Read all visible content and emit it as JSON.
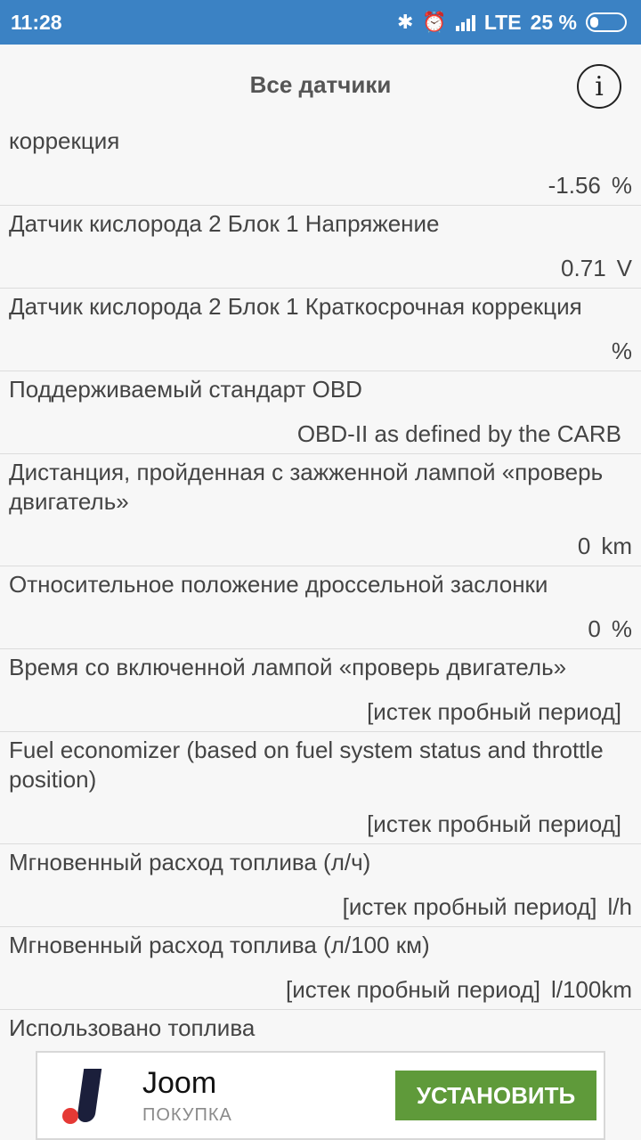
{
  "status_bar": {
    "time": "11:28",
    "network": "LTE",
    "battery_percent_text": "25 %",
    "battery_level": 0.25,
    "icons": [
      "bluetooth-icon",
      "alarm-icon",
      "signal-icon",
      "battery-icon"
    ]
  },
  "header": {
    "title": "Все датчики",
    "info_icon": "i"
  },
  "sensors": [
    {
      "label": "коррекция",
      "value": "-1.56",
      "unit": "%"
    },
    {
      "label": "Датчик кислорода 2 Блок 1 Напряжение",
      "value": "0.71",
      "unit": "V"
    },
    {
      "label": "Датчик кислорода 2 Блок 1 Краткосрочная коррекция",
      "value": "",
      "unit": "%"
    },
    {
      "label": "Поддерживаемый стандарт OBD",
      "value": "OBD-II as defined by the CARB",
      "unit": ""
    },
    {
      "label": "Дистанция, пройденная с зажженной лампой «проверь двигатель»",
      "value": "0",
      "unit": "km"
    },
    {
      "label": "Относительное положение дроссельной заслонки",
      "value": "0",
      "unit": "%"
    },
    {
      "label": "Время со включенной лампой «проверь двигатель»",
      "value": "[истек пробный период]",
      "unit": ""
    },
    {
      "label": "Fuel economizer (based on fuel system status and throttle position)",
      "value": "[истек пробный период]",
      "unit": ""
    },
    {
      "label": "Мгновенный расход топлива (л/ч)",
      "value": "[истек пробный период]",
      "unit": "l/h"
    },
    {
      "label": "Мгновенный расход топлива (л/100 км)",
      "value": "[истек пробный период]",
      "unit": "l/100km"
    },
    {
      "label": "Использовано топлива",
      "value": "",
      "unit": ""
    }
  ],
  "ad": {
    "name": "Joom",
    "subtitle": "ПОКУПКА",
    "install_label": "УСТАНОВИТЬ",
    "button_color": "#5f9a3a"
  },
  "colors": {
    "status_bar": "#3b82c4",
    "background": "#f7f7f7"
  }
}
